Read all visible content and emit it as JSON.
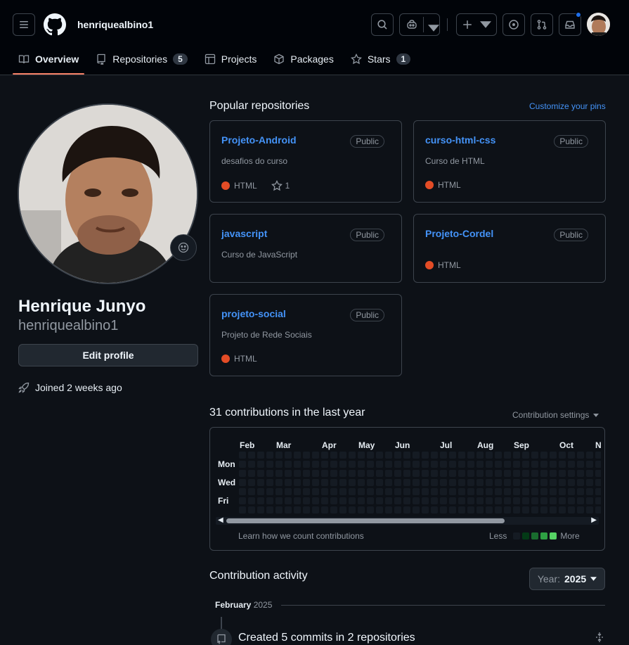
{
  "header": {
    "username": "henriquealbino1",
    "menu_icon": "three-bars-icon",
    "logo_icon": "github-mark-icon"
  },
  "tabs": [
    {
      "label": "Overview",
      "icon": "book-icon",
      "active": true
    },
    {
      "label": "Repositories",
      "icon": "repo-icon",
      "count": "5"
    },
    {
      "label": "Projects",
      "icon": "table-icon"
    },
    {
      "label": "Packages",
      "icon": "package-icon"
    },
    {
      "label": "Stars",
      "icon": "star-icon",
      "count": "1"
    }
  ],
  "profile": {
    "full_name": "Henrique Junyo",
    "login": "henriquealbino1",
    "edit_label": "Edit profile",
    "joined": "Joined 2 weeks ago"
  },
  "popular": {
    "title": "Popular repositories",
    "customize": "Customize your pins",
    "repos": [
      {
        "name": "Projeto-Android",
        "visibility": "Public",
        "description": "desafios do curso",
        "language": "HTML",
        "stars": "1"
      },
      {
        "name": "curso-html-css",
        "visibility": "Public",
        "description": "Curso de HTML",
        "language": "HTML"
      },
      {
        "name": "javascript",
        "visibility": "Public",
        "description": "Curso de JavaScript",
        "language": ""
      },
      {
        "name": "Projeto-Cordel",
        "visibility": "Public",
        "description": "",
        "language": "HTML"
      },
      {
        "name": "projeto-social",
        "visibility": "Public",
        "description": "Projeto de Rede Sociais",
        "language": "HTML"
      }
    ]
  },
  "contributions": {
    "title": "31 contributions in the last year",
    "settings": "Contribution settings",
    "months": [
      "Feb",
      "Mar",
      "Apr",
      "May",
      "Jun",
      "Jul",
      "Aug",
      "Sep",
      "Oct",
      "N"
    ],
    "days": [
      "Mon",
      "Wed",
      "Fri"
    ],
    "learn": "Learn how we count contributions",
    "less": "Less",
    "more": "More",
    "legend_colors": [
      "#151b23",
      "#033a16",
      "#196c2e",
      "#2ea043",
      "#56d364"
    ]
  },
  "activity": {
    "title": "Contribution activity",
    "year_label": "Year:",
    "year_value": "2025",
    "month": "February",
    "month_year": "2025",
    "event": "Created 5 commits in 2 repositories"
  },
  "colors": {
    "accent_tab": "#f78166",
    "link": "#4493f8",
    "html_lang": "#e34c26",
    "notif": "#1f6feb"
  }
}
